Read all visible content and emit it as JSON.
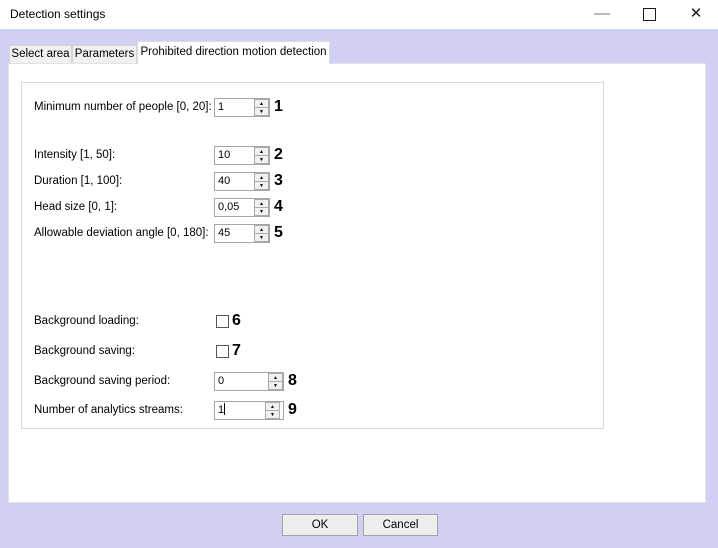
{
  "window": {
    "title": "Detection settings",
    "close_glyph": "✕"
  },
  "tabs": [
    {
      "label": "Select area",
      "active": false
    },
    {
      "label": "Parameters",
      "active": false
    },
    {
      "label": "Prohibited direction motion detection",
      "active": true
    }
  ],
  "group": {
    "rows": [
      {
        "type": "spinner",
        "label": "Minimum number of people [0, 20]:",
        "value": "1",
        "annotation": "1"
      },
      {
        "type": "spinner",
        "label": "Intensity [1, 50]:",
        "value": "10",
        "annotation": "2"
      },
      {
        "type": "spinner",
        "label": "Duration [1, 100]:",
        "value": "40",
        "annotation": "3"
      },
      {
        "type": "spinner",
        "label": "Head size [0, 1]:",
        "value": "0,05",
        "annotation": "4"
      },
      {
        "type": "spinner",
        "label": "Allowable deviation angle [0, 180]:",
        "value": "45",
        "annotation": "5"
      },
      {
        "type": "checkbox",
        "label": "Background loading:",
        "checked": false,
        "annotation": "6"
      },
      {
        "type": "checkbox",
        "label": "Background saving:",
        "checked": false,
        "annotation": "7"
      },
      {
        "type": "spinner",
        "label": "Background saving period:",
        "value": "0",
        "annotation": "8"
      },
      {
        "type": "spinner",
        "label": "Number of analytics streams:",
        "value": "1",
        "annotation": "9",
        "focused": true
      }
    ]
  },
  "footer": {
    "ok_label": "OK",
    "cancel_label": "Cancel"
  },
  "colors": {
    "dialog_background": "#d0d0f5",
    "titlebar_background": "#ffffff",
    "page_background": "#ffffff",
    "inactive_tab_background": "#f0f0f0",
    "control_border": "#a5a5a5",
    "groupbox_border": "#d9d9d9"
  }
}
